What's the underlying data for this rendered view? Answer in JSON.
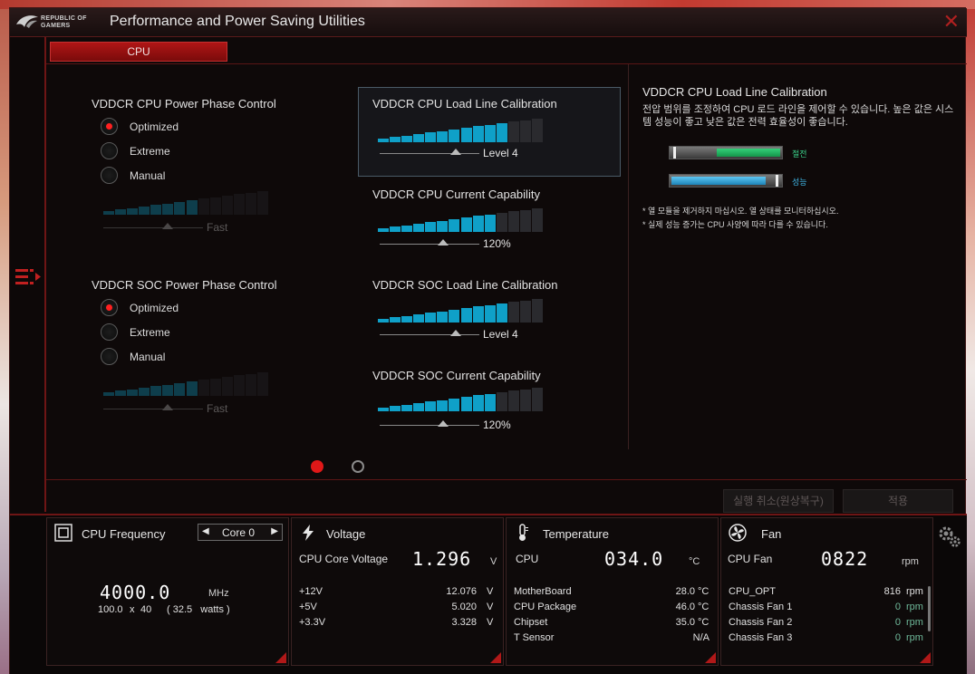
{
  "window": {
    "logo_text": "REPUBLIC OF GAMERS",
    "title": "Performance and Power Saving Utilities",
    "close_glyph": "✕"
  },
  "tabs": [
    {
      "label": "CPU",
      "active": true
    }
  ],
  "cpu_phase": {
    "title": "VDDCR CPU Power Phase Control",
    "options": [
      "Optimized",
      "Extreme",
      "Manual"
    ],
    "selected": "Optimized",
    "slider_label": "Fast"
  },
  "soc_phase": {
    "title": "VDDCR SOC Power Phase Control",
    "options": [
      "Optimized",
      "Extreme",
      "Manual"
    ],
    "selected": "Optimized",
    "slider_label": "Fast"
  },
  "cpu_llc": {
    "title": "VDDCR CPU Load Line Calibration",
    "value": "Level 4",
    "level_fraction": 0.82
  },
  "cpu_current": {
    "title": "VDDCR CPU Current Capability",
    "value": "120%",
    "level_fraction": 0.7
  },
  "soc_llc": {
    "title": "VDDCR SOC Load Line Calibration",
    "value": "Level 4",
    "level_fraction": 0.82
  },
  "soc_current": {
    "title": "VDDCR SOC Current Capability",
    "value": "120%",
    "level_fraction": 0.7
  },
  "info": {
    "title": "VDDCR CPU Load Line Calibration",
    "description": "전압 범위를 조정하여 CPU 로드 라인을 제어할 수 있습니다. 높은 값은 시스템 성능이 좋고 낮은 값은 전력 효율성이 좋습니다.",
    "bar1_label": "절전",
    "bar2_label": "성능",
    "note1": "* 열 모듈을 제거하지 마십시오. 열 상태를 모니터하십시오.",
    "note2": "* 실제 성능 증가는 CPU 사양에 따라 다를 수 있습니다."
  },
  "pager": {
    "pages": 2,
    "current": 1
  },
  "buttons": {
    "undo": "실행 취소(원상복구)",
    "apply": "적용"
  },
  "colors": {
    "accent": "#b01616",
    "ramp_on": "#0fa0c8",
    "power_save": "#1fb35a",
    "performance": "#2fa6d8"
  },
  "cpu_freq": {
    "title": "CPU Frequency",
    "core": "Core 0",
    "freq": "4000.0",
    "freq_unit": "MHz",
    "base": "100.0",
    "x": "x",
    "mult": "40",
    "watts": "( 32.5   watts )"
  },
  "voltage": {
    "title": "Voltage",
    "main_label": "CPU Core Voltage",
    "main_value": "1.296",
    "main_unit": "V",
    "rows": [
      {
        "label": "+12V",
        "value": "12.076",
        "unit": "V"
      },
      {
        "label": "+5V",
        "value": "5.020",
        "unit": "V"
      },
      {
        "label": "+3.3V",
        "value": "3.328",
        "unit": "V"
      }
    ]
  },
  "temperature": {
    "title": "Temperature",
    "main_label": "CPU",
    "main_value": "034.0",
    "main_unit": "°C",
    "rows": [
      {
        "label": "MotherBoard",
        "value": "28.0",
        "unit": "°C"
      },
      {
        "label": "CPU Package",
        "value": "46.0",
        "unit": "°C"
      },
      {
        "label": "Chipset",
        "value": "35.0",
        "unit": "°C"
      },
      {
        "label": "T Sensor",
        "value": "N/A",
        "unit": ""
      }
    ]
  },
  "fan": {
    "title": "Fan",
    "main_label": "CPU Fan",
    "main_value": "0822",
    "main_unit": "rpm",
    "rows": [
      {
        "label": "CPU_OPT",
        "value": "816",
        "unit": "rpm"
      },
      {
        "label": "Chassis Fan 1",
        "value": "0",
        "unit": "rpm"
      },
      {
        "label": "Chassis Fan 2",
        "value": "0",
        "unit": "rpm"
      },
      {
        "label": "Chassis Fan 3",
        "value": "0",
        "unit": "rpm"
      }
    ]
  }
}
